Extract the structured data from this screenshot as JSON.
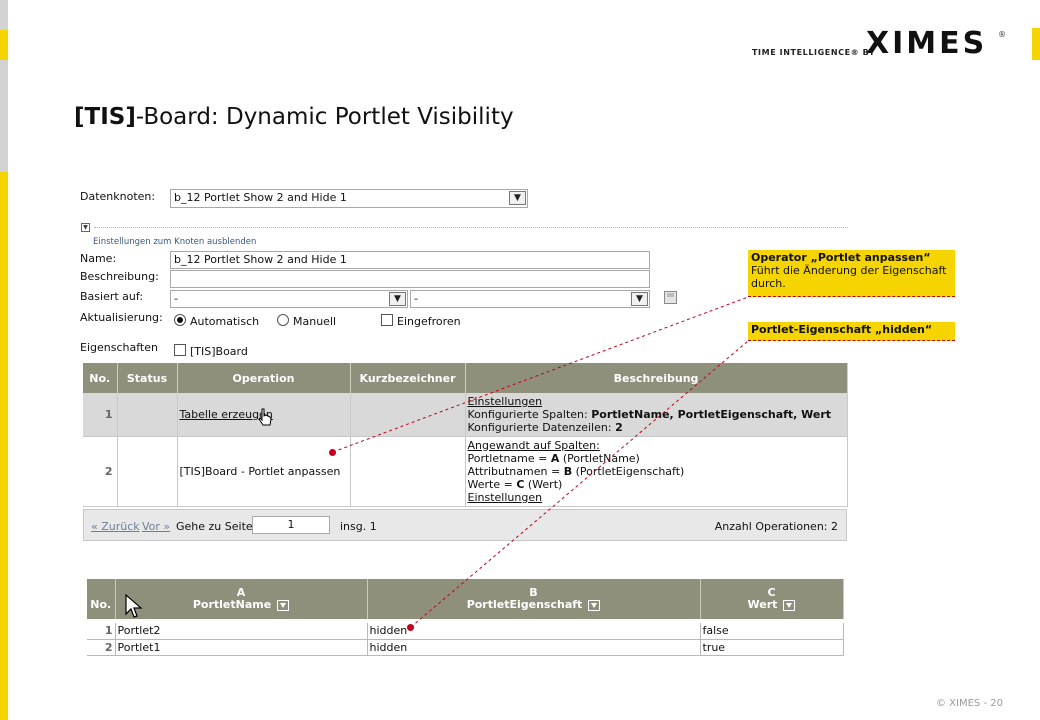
{
  "brand": {
    "tagline": "TIME INTELLIGENCE® BY",
    "logo_text": "XIMES",
    "logo_reg": "®",
    "accent": "#f5d400"
  },
  "slide": {
    "title_bold": "[TIS]",
    "title_rest": "-Board: Dynamic Portlet Visibility",
    "copyright": "© XIMES - 20"
  },
  "form": {
    "datenknoten_label": "Datenknoten:",
    "datenknoten_value": "b_12 Portlet Show 2 and Hide 1",
    "toggle_link": "Einstellungen zum Knoten ausblenden",
    "name_label": "Name:",
    "name_value": "b_12 Portlet Show 2 and Hide 1",
    "beschreibung_label": "Beschreibung:",
    "beschreibung_value": "",
    "basiert_label": "Basiert auf:",
    "basiert_value_1": "-",
    "basiert_value_2": "-",
    "aktualisierung_label": "Aktualisierung:",
    "radio_auto": "Automatisch",
    "radio_manual": "Manuell",
    "chk_frozen": "Eingefroren",
    "eigenschaften_label": "Eigenschaften",
    "chk_board": "[TIS]Board"
  },
  "operations": {
    "headers": [
      "No.",
      "Status",
      "Operation",
      "Kurzbezeichner",
      "Beschreibung"
    ],
    "rows": [
      {
        "no": "1",
        "status": "",
        "operation": "Tabelle erzeugen",
        "kurz": "",
        "desc_link": "Einstellungen",
        "desc_l2_pre": "Konfigurierte Spalten: ",
        "desc_l2_bold": "PortletName, PortletEigenschaft, Wert",
        "desc_l3_pre": "Konfigurierte Datenzeilen: ",
        "desc_l3_bold": "2"
      },
      {
        "no": "2",
        "status": "",
        "operation": "[TIS]Board - Portlet anpassen",
        "kurz": "",
        "desc_l1": "Angewandt auf Spalten:",
        "desc_l2_pre": "Portletname = ",
        "desc_l2_bold": "A",
        "desc_l2_post": " (PortletName)",
        "desc_l3_pre": "Attributnamen = ",
        "desc_l3_bold": "B",
        "desc_l3_post": " (PortletEigenschaft)",
        "desc_l4_pre": "Werte = ",
        "desc_l4_bold": "C",
        "desc_l4_post": " (Wert)",
        "desc_link": "Einstellungen"
      }
    ],
    "pager": {
      "prev": "« Zurück",
      "next": "Vor »",
      "goto": "Gehe zu Seite",
      "page": "1",
      "total": "insg. 1",
      "count": "Anzahl Operationen: 2"
    }
  },
  "datatable": {
    "no_header": "No.",
    "columns": [
      {
        "letter": "A",
        "name": "PortletName"
      },
      {
        "letter": "B",
        "name": "PortletEigenschaft"
      },
      {
        "letter": "C",
        "name": "Wert"
      }
    ],
    "rows": [
      {
        "no": "1",
        "a": "Portlet2",
        "b": "hidden",
        "c": "false"
      },
      {
        "no": "2",
        "a": "Portlet1",
        "b": "hidden",
        "c": "true"
      }
    ]
  },
  "callouts": {
    "operator_title": "Operator „Portlet anpassen“",
    "operator_text_1": "Führt die Änderung der Eigenschaft",
    "operator_text_2": "durch.",
    "property_title": "Portlet-Eigenschaft „hidden“"
  }
}
